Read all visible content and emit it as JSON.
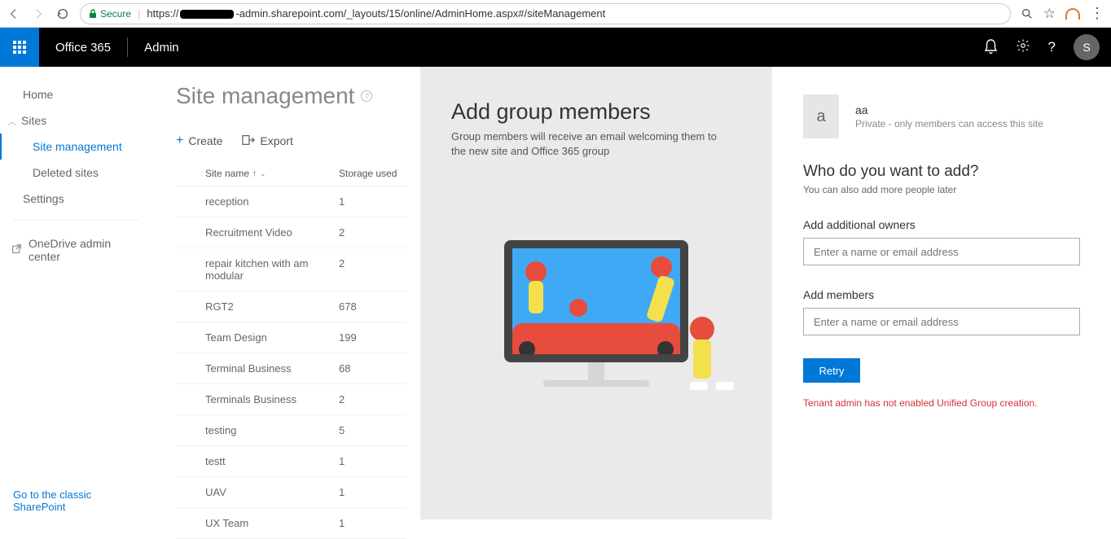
{
  "chrome": {
    "secure_label": "Secure",
    "url_prefix": "https://",
    "url_rest": "-admin.sharepoint.com/_layouts/15/online/AdminHome.aspx#/siteManagement"
  },
  "suite": {
    "brand": "Office 365",
    "app": "Admin",
    "avatar_initial": "S"
  },
  "sidebar": {
    "home": "Home",
    "sites": "Sites",
    "site_management": "Site management",
    "deleted_sites": "Deleted sites",
    "settings": "Settings",
    "onedrive": "OneDrive admin center",
    "classic_link": "Go to the classic SharePoint"
  },
  "page": {
    "title": "Site management",
    "help": "?",
    "create": "Create",
    "export": "Export"
  },
  "table": {
    "col_name": "Site name",
    "col_storage": "Storage used",
    "rows": [
      {
        "name": "reception",
        "storage": "1"
      },
      {
        "name": "Recruitment Video",
        "storage": "2"
      },
      {
        "name": "repair kitchen with am modular",
        "storage": "2"
      },
      {
        "name": "RGT2",
        "storage": "678"
      },
      {
        "name": "Team Design",
        "storage": "199"
      },
      {
        "name": "Terminal Business",
        "storage": "68"
      },
      {
        "name": "Terminals Business",
        "storage": "2"
      },
      {
        "name": "testing",
        "storage": "5"
      },
      {
        "name": "testt",
        "storage": "1"
      },
      {
        "name": "UAV",
        "storage": "1"
      },
      {
        "name": "UX Team",
        "storage": "1"
      }
    ]
  },
  "center": {
    "title": "Add group members",
    "subtitle": "Group members will receive an email welcoming them to the new site and Office 365 group"
  },
  "right": {
    "group_initial": "a",
    "group_name": "aa",
    "group_privacy": "Private - only members can access this site",
    "question": "Who do you want to add?",
    "question_sub": "You can also add more people later",
    "owners_label": "Add additional owners",
    "members_label": "Add members",
    "placeholder": "Enter a name or email address",
    "retry": "Retry",
    "error": "Tenant admin has not enabled Unified Group creation."
  }
}
